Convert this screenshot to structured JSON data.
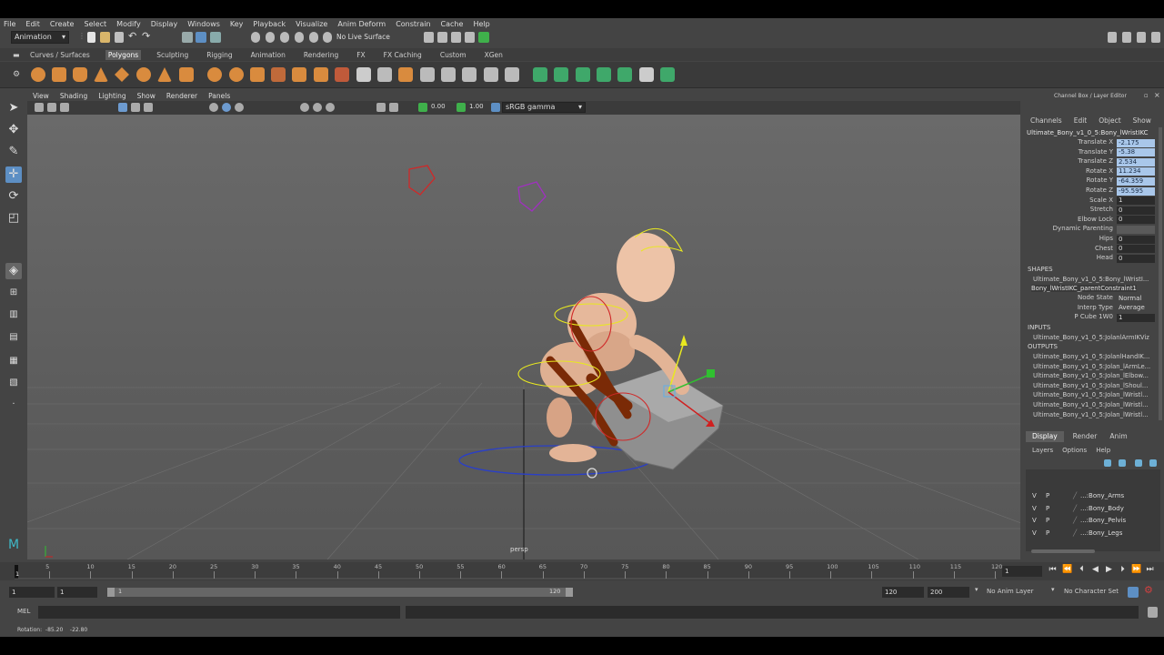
{
  "menubar": [
    "File",
    "Edit",
    "Create",
    "Select",
    "Modify",
    "Display",
    "Windows",
    "Key",
    "Playback",
    "Visualize",
    "Anim Deform",
    "Constrain",
    "Cache",
    "Help"
  ],
  "status": {
    "mode": "Animation",
    "live_surface": "No Live Surface"
  },
  "shelf_tabs": [
    "Curves / Surfaces",
    "Polygons",
    "Sculpting",
    "Rigging",
    "Animation",
    "Rendering",
    "FX",
    "FX Caching",
    "Custom",
    "XGen"
  ],
  "panel_menu": [
    "View",
    "Shading",
    "Lighting",
    "Show",
    "Renderer",
    "Panels"
  ],
  "panel_toolbar": {
    "exposure": "0.00",
    "gamma": "1.00",
    "color_space": "sRGB gamma"
  },
  "viewport": {
    "camera_label": "persp"
  },
  "channel_box": {
    "title": "Channel Box / Layer Editor",
    "menu": [
      "Channels",
      "Edit",
      "Object",
      "Show"
    ],
    "object_name": "Ultimate_Bony_v1_0_5:Bony_lWristIKC",
    "channels": [
      {
        "label": "Translate X",
        "value": "-2.175",
        "selected": true
      },
      {
        "label": "Translate Y",
        "value": "-5.38",
        "selected": true
      },
      {
        "label": "Translate Z",
        "value": "2.534",
        "selected": true
      },
      {
        "label": "Rotate X",
        "value": "11.234",
        "selected": true
      },
      {
        "label": "Rotate Y",
        "value": "-64.359",
        "selected": true
      },
      {
        "label": "Rotate Z",
        "value": "-95.595",
        "selected": true
      },
      {
        "label": "Scale X",
        "value": "1",
        "selected": false
      },
      {
        "label": "Stretch",
        "value": "0",
        "selected": false
      },
      {
        "label": "Elbow Lock",
        "value": "0",
        "selected": false
      },
      {
        "label": "Dynamic Parenting",
        "value": "",
        "selected": false
      },
      {
        "label": "Hips",
        "value": "0",
        "selected": false
      },
      {
        "label": "Chest",
        "value": "0",
        "selected": false
      },
      {
        "label": "Head",
        "value": "0",
        "selected": false
      }
    ],
    "shapes_header": "SHAPES",
    "shapes": [
      "Ultimate_Bony_v1_0_5:Bony_lWristI...",
      "Bony_lWristIKC_parentConstraint1"
    ],
    "constraint_attrs": [
      {
        "label": "Node State",
        "value": "Normal"
      },
      {
        "label": "Interp Type",
        "value": "Average"
      },
      {
        "label": "P Cube 1W0",
        "value": "1"
      }
    ],
    "inputs_header": "INPUTS",
    "inputs": [
      "Ultimate_Bony_v1_0_5:JolanlArmIKViz"
    ],
    "outputs_header": "OUTPUTS",
    "outputs": [
      "Ultimate_Bony_v1_0_5:JolanlHandIK...",
      "Ultimate_Bony_v1_0_5:Jolan_lArmLe...",
      "Ultimate_Bony_v1_0_5:Jolan_lElbow...",
      "Ultimate_Bony_v1_0_5:Jolan_lShoul...",
      "Ultimate_Bony_v1_0_5:Jolan_lWristl...",
      "Ultimate_Bony_v1_0_5:Jolan_lWristl...",
      "Ultimate_Bony_v1_0_5:Jolan_lWristl..."
    ]
  },
  "layer_editor": {
    "tabs": [
      "Display",
      "Render",
      "Anim"
    ],
    "menu": [
      "Layers",
      "Options",
      "Help"
    ],
    "layers": [
      {
        "v": "V",
        "p": "P",
        "name": "...:Bony_Arms"
      },
      {
        "v": "V",
        "p": "P",
        "name": "...:Bony_Body"
      },
      {
        "v": "V",
        "p": "P",
        "name": "...:Bony_Pelvis"
      },
      {
        "v": "V",
        "p": "P",
        "name": "...:Bony_Legs"
      }
    ]
  },
  "timeline": {
    "ticks": [
      "5",
      "10",
      "15",
      "20",
      "25",
      "30",
      "35",
      "40",
      "45",
      "50",
      "55",
      "60",
      "65",
      "70",
      "75",
      "80",
      "85",
      "90",
      "95",
      "100",
      "105",
      "110",
      "115",
      "120"
    ],
    "first_tick": "1",
    "current_frame": "1"
  },
  "range": {
    "start": "1",
    "playback_start": "1",
    "slider_start": "1",
    "slider_end": "120",
    "playback_end": "120",
    "end": "200",
    "anim_layer": "No Anim Layer",
    "character_set": "No Character Set"
  },
  "mel": {
    "label": "MEL"
  },
  "help_line": "Rotation:  -85.20    -22.80",
  "colors": {
    "selection": "#a9c7ea",
    "active_tab": "#5d5d5d",
    "panel_bg": "#444444"
  }
}
